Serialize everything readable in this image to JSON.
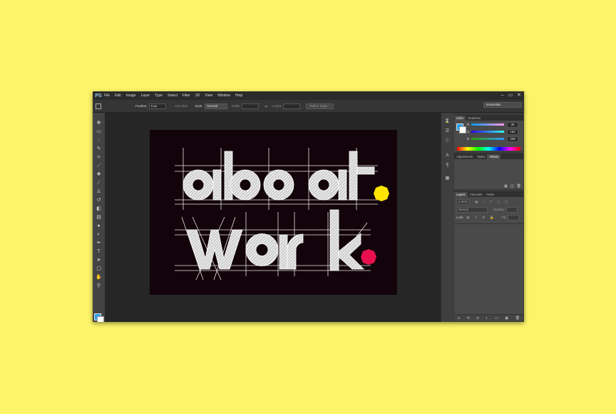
{
  "app": {
    "logo": "PS"
  },
  "menu": [
    "File",
    "Edit",
    "Image",
    "Layer",
    "Type",
    "Select",
    "Filter",
    "3D",
    "View",
    "Window",
    "Help"
  ],
  "window_controls": [
    "–",
    "▭",
    "✕"
  ],
  "options_bar": {
    "feather_label": "Feather:",
    "feather_value": "0 px",
    "anti_alias_label": "Anti-alias",
    "style_label": "Style:",
    "style_value": "Normal",
    "width_label": "Width:",
    "height_label": "Height:",
    "refine_edge": "Refine Edge..."
  },
  "workspace": "Essentials",
  "canvas": {
    "line1": "about",
    "line2": "work",
    "dot_colors": {
      "yellow": "#ffe600",
      "pink": "#e8104f"
    }
  },
  "color_panel": {
    "tabs": [
      "Color",
      "Swatches"
    ],
    "r_label": "R",
    "r_value": "46",
    "g_label": "G",
    "g_value": "152",
    "b_label": "B",
    "b_value": "238"
  },
  "adjust_panel": {
    "tabs": [
      "Adjustments",
      "Styles",
      "History"
    ]
  },
  "layers_panel": {
    "tabs": [
      "Layers",
      "Channels",
      "Paths"
    ],
    "kind": "ρ Kind",
    "blend": "Normal",
    "opacity_label": "Opacity:",
    "lock_label": "Lock:",
    "fill_label": "Fill:"
  },
  "colors": {
    "foreground": "#2aa1ee",
    "background": "#ffffff",
    "page_bg": "#fdf46a"
  }
}
